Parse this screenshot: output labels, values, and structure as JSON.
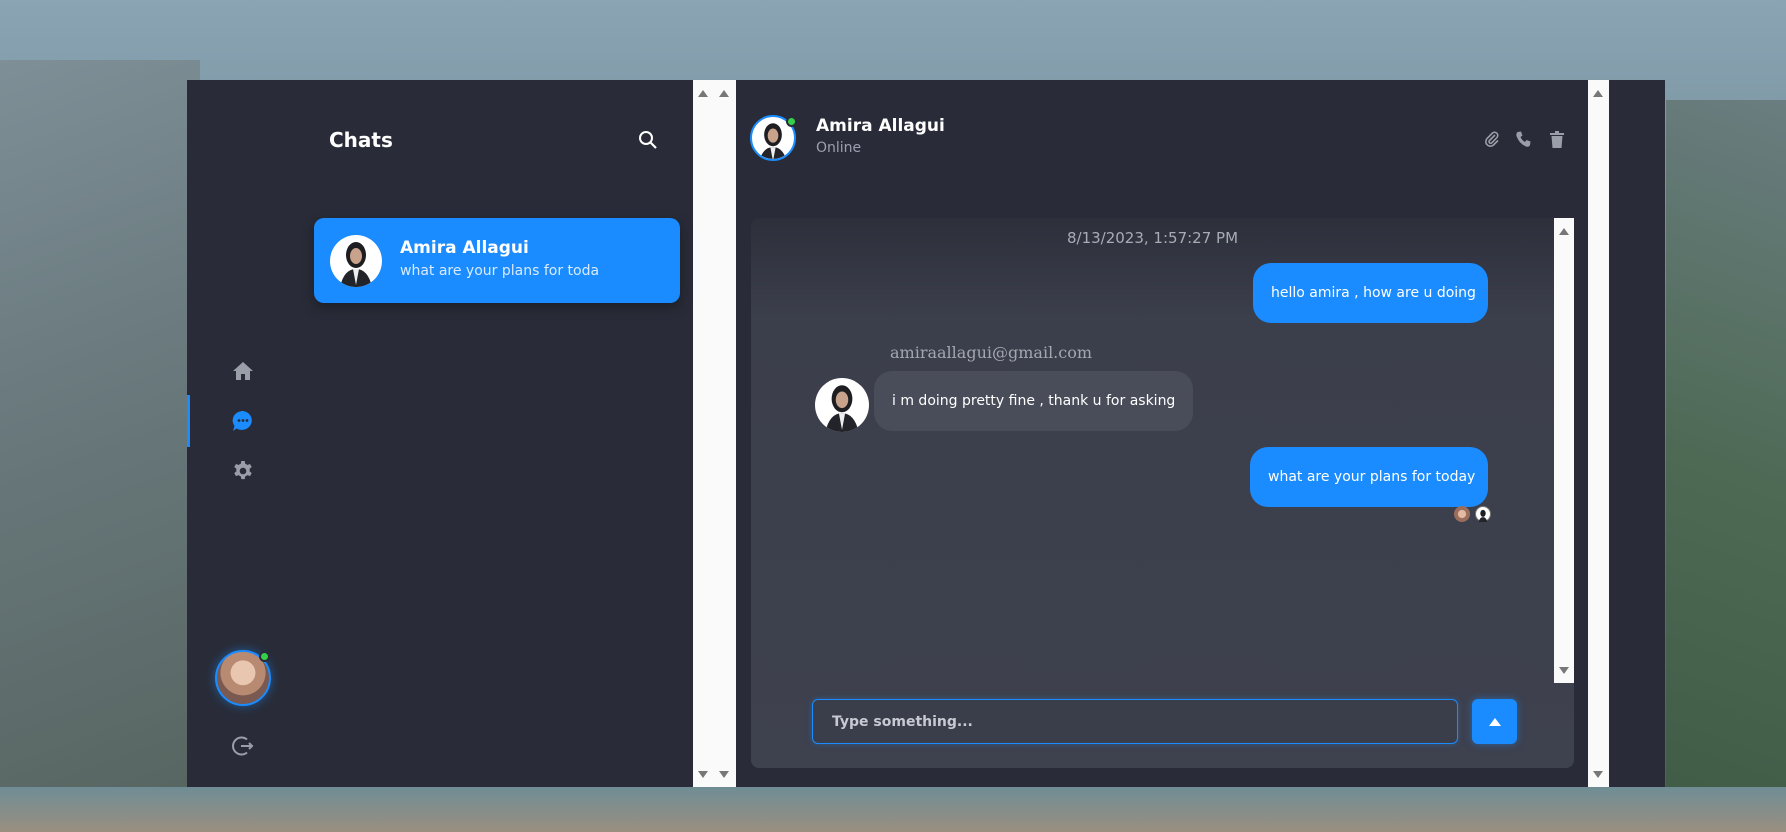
{
  "chats": {
    "title": "Chats",
    "items": [
      {
        "name": "Amira Allagui",
        "last_message": "what are your plans for toda"
      }
    ]
  },
  "conversation": {
    "contact_name": "Amira Allagui",
    "contact_status": "Online",
    "timestamp": "8/13/2023, 1:57:27 PM",
    "messages": [
      {
        "from": "me",
        "text": "hello amira , how are u doing"
      },
      {
        "from": "them",
        "sender": "amiraallagui@gmail.com",
        "text": "i m doing pretty fine , thank u for asking"
      },
      {
        "from": "me",
        "text": "what are your plans for today"
      }
    ],
    "input_placeholder": "Type something..."
  },
  "colors": {
    "accent": "#1a8cff",
    "panel": "#292c38",
    "online": "#35d04a"
  },
  "icons": {
    "nav": [
      "home-icon",
      "chat-icon",
      "gear-icon",
      "logout-icon"
    ],
    "header": [
      "paperclip-icon",
      "phone-icon",
      "trash-icon"
    ],
    "search": "search-icon",
    "send": "send-arrow-icon"
  }
}
